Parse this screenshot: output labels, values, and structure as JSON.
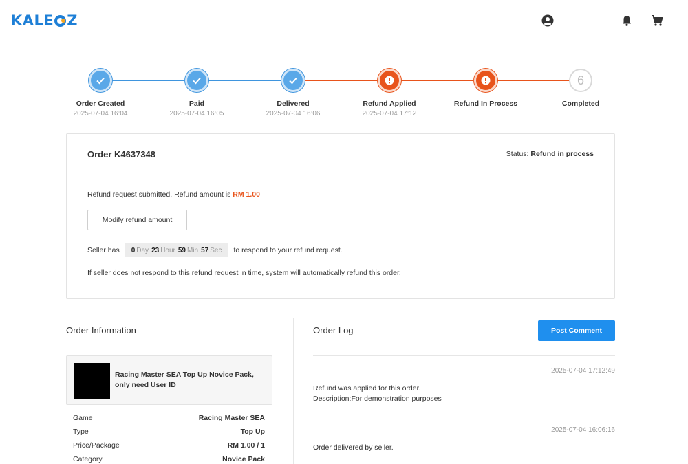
{
  "header": {
    "logo": "KALEOZ",
    "icons": [
      "account-icon",
      "bell-icon",
      "cart-icon"
    ]
  },
  "colors": {
    "blue": "#3f95de",
    "orange": "#e8541c",
    "grey": "#d9d9d9",
    "accent_button": "#1f8fee"
  },
  "steps": [
    {
      "label": "Order Created",
      "time": "2025-07-04 16:04",
      "state": "done"
    },
    {
      "label": "Paid",
      "time": "2025-07-04 16:05",
      "state": "done"
    },
    {
      "label": "Delivered",
      "time": "2025-07-04 16:06",
      "state": "done"
    },
    {
      "label": "Refund Applied",
      "time": "2025-07-04 17:12",
      "state": "warn"
    },
    {
      "label": "Refund In Process",
      "time": "",
      "state": "warn"
    },
    {
      "label": "Completed",
      "time": "",
      "state": "todo",
      "number": "6"
    }
  ],
  "order": {
    "title": "Order K4637348",
    "status_label": "Status:",
    "status_value": "Refund in process",
    "refund_msg": "Refund request submitted. Refund amount is",
    "refund_amount": "RM 1.00",
    "modify_button": "Modify refund amount",
    "seller_prefix": "Seller has",
    "timer": {
      "days": "0",
      "days_unit": "Day",
      "hours": "23",
      "hours_unit": "Hour",
      "mins": "59",
      "mins_unit": "Min",
      "secs": "57",
      "secs_unit": "Sec"
    },
    "seller_suffix": "to respond to your refund request.",
    "auto_msg": "If seller does not respond to this refund request in time, system will automatically refund this order."
  },
  "order_info": {
    "title": "Order Information",
    "product_name": "Racing Master SEA Top Up Novice Pack, only need User ID",
    "rows": [
      {
        "label": "Game",
        "value": "Racing Master SEA"
      },
      {
        "label": "Type",
        "value": "Top Up"
      },
      {
        "label": "Price/Package",
        "value": "RM 1.00 / 1"
      },
      {
        "label": "Category",
        "value": "Novice Pack"
      }
    ]
  },
  "order_log": {
    "title": "Order Log",
    "post_button": "Post Comment",
    "entries": [
      {
        "time": "2025-07-04 17:12:49",
        "line1": "Refund was applied for this order.",
        "line2": "Description:For demonstration purposes"
      },
      {
        "time": "2025-07-04 16:06:16",
        "line1": "Order delivered by seller.",
        "line2": ""
      }
    ]
  }
}
